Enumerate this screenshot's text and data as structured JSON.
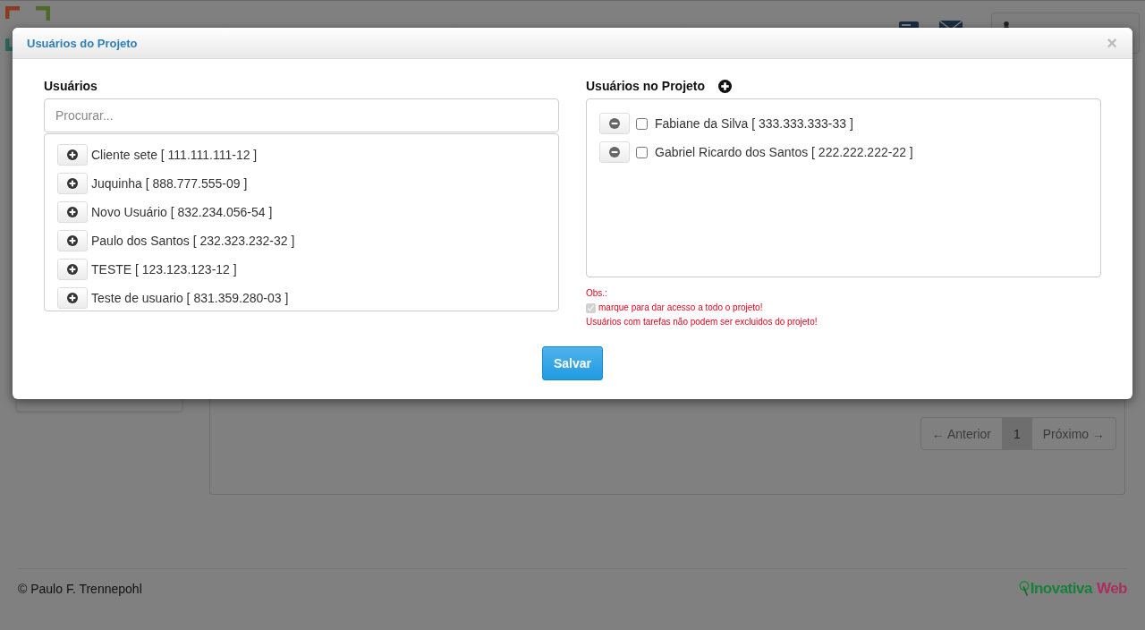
{
  "page": {
    "pagination": [
      {
        "label": "← Anterior",
        "selected": false
      },
      {
        "label": "1",
        "selected": true
      },
      {
        "label": "Próximo →",
        "selected": false
      }
    ],
    "footer": {
      "copyright": "© Paulo F. Trennepohl",
      "brand": [
        "Inovativa",
        "Web"
      ]
    }
  },
  "modal": {
    "title": "Usuários do Projeto",
    "close": "×",
    "available": {
      "heading": "Usuários",
      "search": {
        "placeholder": "Procurar..."
      },
      "users": [
        {
          "name": "Cliente sete [ 111.111.111-12 ]"
        },
        {
          "name": "Juquinha [ 888.777.555-09 ]"
        },
        {
          "name": "Novo Usuário [ 832.234.056-54 ]"
        },
        {
          "name": "Paulo dos Santos [ 232.323.232-32 ]"
        },
        {
          "name": "TESTE [ 123.123.123-12 ]"
        },
        {
          "name": "Teste de usuario [ 831.359.280-03 ]"
        }
      ]
    },
    "members": {
      "heading": "Usuários no Projeto",
      "users": [
        {
          "name": "Fabiane da Silva [ 333.333.333-33 ]",
          "checked": false
        },
        {
          "name": "Gabriel Ricardo dos Santos [ 222.222.222-22 ]",
          "checked": false
        }
      ]
    },
    "notes": {
      "label": "Obs.:",
      "legend_checked": true,
      "legend": "marque para dar acesso a todo o projeto!",
      "warning": "Usuários com tarefas não podem ser excluidos do projeto!"
    },
    "save": "Salvar"
  }
}
